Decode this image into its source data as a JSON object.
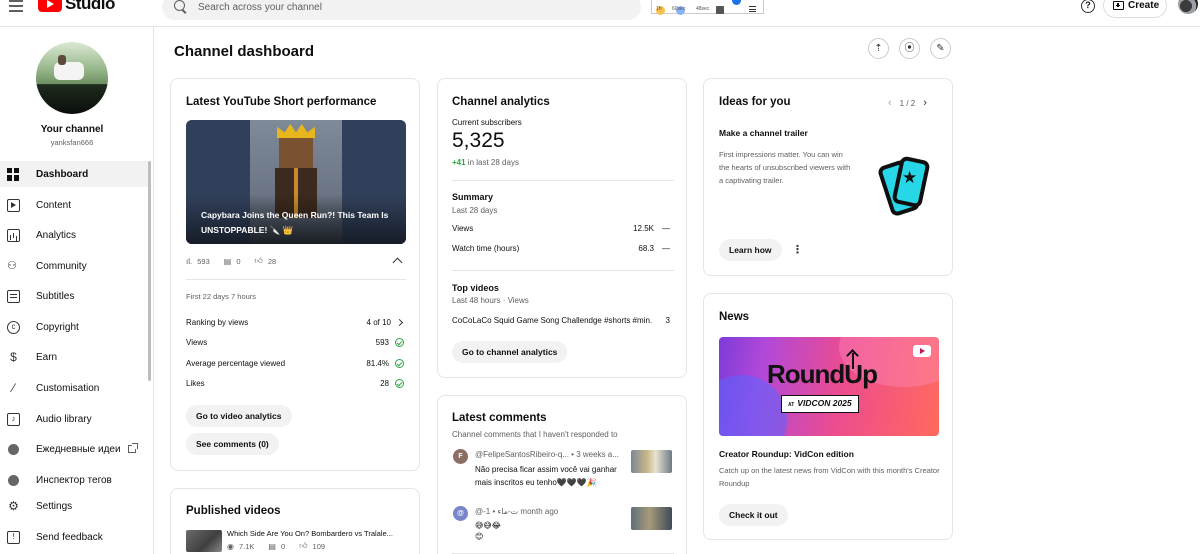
{
  "topbar": {
    "studio_label": "Studio",
    "search_placeholder": "Search across your channel",
    "ext_labels": [
      "0",
      "0",
      "1h",
      "60sec",
      "48sec"
    ],
    "help_glyph": "?",
    "create_label": "Create"
  },
  "sidebar": {
    "channel_name": "Your channel",
    "handle": "yanksfan666",
    "items": [
      {
        "label": "Dashboard",
        "icon": "dashboard-icon",
        "active": true
      },
      {
        "label": "Content",
        "icon": "content-icon"
      },
      {
        "label": "Analytics",
        "icon": "analytics-icon"
      },
      {
        "label": "Community",
        "icon": "community-icon"
      },
      {
        "label": "Subtitles",
        "icon": "subtitles-icon"
      },
      {
        "label": "Copyright",
        "icon": "copyright-icon"
      },
      {
        "label": "Earn",
        "icon": "dollar-icon"
      },
      {
        "label": "Customisation",
        "icon": "magic-wand-icon"
      },
      {
        "label": "Audio library",
        "icon": "audio-library-icon"
      },
      {
        "label": "Ежедневные идеи",
        "icon": "extension-dot-icon"
      },
      {
        "label": "Инспектор тегов",
        "icon": "extension-dot-icon"
      },
      {
        "label": "Settings",
        "icon": "gear-icon"
      },
      {
        "label": "Send feedback",
        "icon": "feedback-icon"
      }
    ]
  },
  "main": {
    "title": "Channel dashboard"
  },
  "short_card": {
    "title": "Latest YouTube Short performance",
    "video_title": "Capybara Joins the Queen Run?! This Team Is UNSTOPPABLE! 🔪 👑",
    "views": "593",
    "comments": "0",
    "likes": "28",
    "period": "First 22 days 7 hours",
    "ranking_label": "Ranking by views",
    "ranking_value": "4 of 10",
    "metrics": [
      {
        "label": "Views",
        "value": "593"
      },
      {
        "label": "Average percentage viewed",
        "value": "81.4%"
      },
      {
        "label": "Likes",
        "value": "28"
      }
    ],
    "analytics_button": "Go to video analytics",
    "comments_button": "See comments (0)"
  },
  "published_card": {
    "title": "Published videos",
    "video_title": "Which Side Are You On? Bombardero vs Tralale...",
    "views": "7.1K",
    "comments": "0",
    "likes": "109"
  },
  "analytics_card": {
    "title": "Channel analytics",
    "subscribers_label": "Current subscribers",
    "subscribers": "5,325",
    "change": "+41",
    "change_suffix": " in last 28 days",
    "summary_title": "Summary",
    "summary_period": "Last 28 days",
    "summary": [
      {
        "label": "Views",
        "value": "12.5K",
        "trend": "—"
      },
      {
        "label": "Watch time (hours)",
        "value": "68.3",
        "trend": "—"
      }
    ],
    "top_title": "Top videos",
    "top_period": "Last 48 hours · Views",
    "top_video": "CoCoLaCo Squid Game Song Challendge #shorts #min...",
    "top_views": "3",
    "button": "Go to channel analytics"
  },
  "comments_card": {
    "title": "Latest comments",
    "subtitle": "Channel comments that I haven't responded to",
    "items": [
      {
        "initial": "F",
        "meta": "@FelipeSantosRibeiro-q... • 3 weeks a...",
        "text": "Não precisa ficar assim você vai ganhar mais inscritos eu tenho🖤🖤🖤🎉"
      },
      {
        "initial": "@",
        "meta": "@-ت-ماء • 1 month ago",
        "text": "😅😅😂\n😊"
      }
    ]
  },
  "ideas_card": {
    "title": "Ideas for you",
    "pager": "1 / 2",
    "idea_title": "Make a channel trailer",
    "idea_text": "First impressions matter. You can win the hearts of unsubscribed viewers with a captivating trailer.",
    "button": "Learn how"
  },
  "news_card": {
    "title": "News",
    "banner_main": "RoundUp",
    "banner_at": "AT",
    "banner_sub": "VIDCON 2025",
    "headline": "Creator Roundup: VidCon edition",
    "body": "Catch up on the latest news from VidCon with this month's Creator Roundup",
    "button": "Check it out"
  },
  "colors": {
    "brand_red": "#ff0000",
    "positive_green": "#2ba640",
    "active_nav": "#f2f2f2"
  }
}
